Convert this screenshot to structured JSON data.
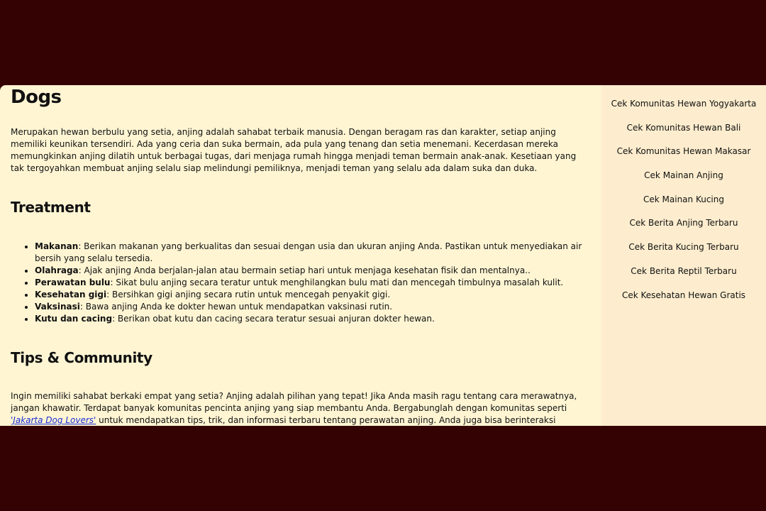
{
  "main": {
    "title": "Dogs",
    "intro": "Merupakan hewan berbulu yang setia, anjing adalah sahabat terbaik manusia. Dengan beragam ras dan karakter, setiap anjing memiliki keunikan tersendiri. Ada yang ceria dan suka bermain, ada pula yang tenang dan setia menemani. Kecerdasan mereka memungkinkan anjing dilatih untuk berbagai tugas, dari menjaga rumah hingga menjadi teman bermain anak-anak. Kesetiaan yang tak tergoyahkan membuat anjing selalu siap melindungi pemiliknya, menjadi teman yang selalu ada dalam suka dan duka.",
    "treatment": {
      "heading": "Treatment",
      "items": [
        {
          "term": "Makanan",
          "text": ": Berikan makanan yang berkualitas dan sesuai dengan usia dan ukuran anjing Anda. Pastikan untuk menyediakan air bersih yang selalu tersedia."
        },
        {
          "term": "Olahraga",
          "text": ": Ajak anjing Anda berjalan-jalan atau bermain setiap hari untuk menjaga kesehatan fisik dan mentalnya.."
        },
        {
          "term": "Perawatan bulu",
          "text": ": Sikat bulu anjing secara teratur untuk menghilangkan bulu mati dan mencegah timbulnya masalah kulit."
        },
        {
          "term": "Kesehatan gigi",
          "text": ": Bersihkan gigi anjing secara rutin untuk mencegah penyakit gigi."
        },
        {
          "term": "Vaksinasi",
          "text": ": Bawa anjing Anda ke dokter hewan untuk mendapatkan vaksinasi rutin."
        },
        {
          "term": "Kutu dan cacing",
          "text": ": Berikan obat kutu dan cacing secara teratur sesuai anjuran dokter hewan."
        }
      ]
    },
    "tips": {
      "heading": "Tips & Community",
      "text_before": "Ingin memiliki sahabat berkaki empat yang setia? Anjing adalah pilihan yang tepat! Jika Anda masih ragu tentang cara merawatnya, jangan khawatir. Terdapat banyak komunitas pencinta anjing yang siap membantu Anda. Bergabunglah dengan komunitas seperti ",
      "link_text": "'Jakarta Dog Lovers'",
      "text_after": " untuk mendapatkan tips, trik, dan informasi terbaru tentang perawatan anjing. Anda juga bisa berinteraksi dengan sesama pecinta anjing dan"
    }
  },
  "sidebar": {
    "links": [
      "Cek Komunitas Hewan Yogyakarta",
      "Cek Komunitas Hewan Bali",
      "Cek Komunitas Hewan Makasar",
      "Cek Mainan Anjing",
      "Cek Mainan Kucing",
      "Cek Berita Anjing Terbaru",
      "Cek Berita Kucing Terbaru",
      "Cek Berita Reptil Terbaru",
      "Cek Kesehatan Hewan Gratis"
    ]
  },
  "colors": {
    "frame": "#350203",
    "content_bg": "#fff5d3",
    "sidebar_bg": "#fdedce",
    "link": "#1a2fd6"
  }
}
